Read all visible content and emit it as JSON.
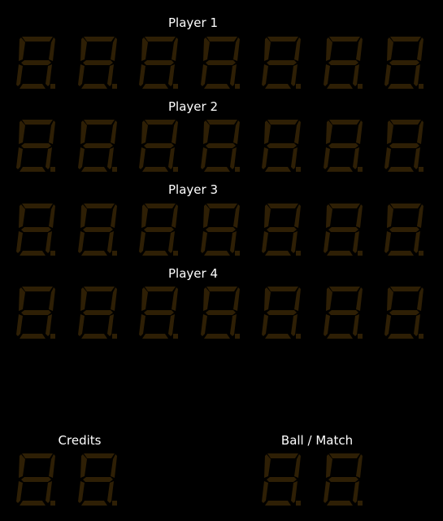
{
  "players": [
    {
      "label": "Player 1",
      "digits": [
        "",
        "",
        "",
        "",
        "",
        "",
        ""
      ]
    },
    {
      "label": "Player 2",
      "digits": [
        "",
        "",
        "",
        "",
        "",
        "",
        ""
      ]
    },
    {
      "label": "Player 3",
      "digits": [
        "",
        "",
        "",
        "",
        "",
        "",
        ""
      ]
    },
    {
      "label": "Player 4",
      "digits": [
        "",
        "",
        "",
        "",
        "",
        "",
        ""
      ]
    }
  ],
  "credits": {
    "label": "Credits",
    "digits": [
      "",
      ""
    ]
  },
  "ball_match": {
    "label": "Ball / Match",
    "digits": [
      "",
      ""
    ]
  },
  "colors": {
    "background": "#000000",
    "segment_off": "#2e1f05",
    "label": "#ffffff"
  }
}
